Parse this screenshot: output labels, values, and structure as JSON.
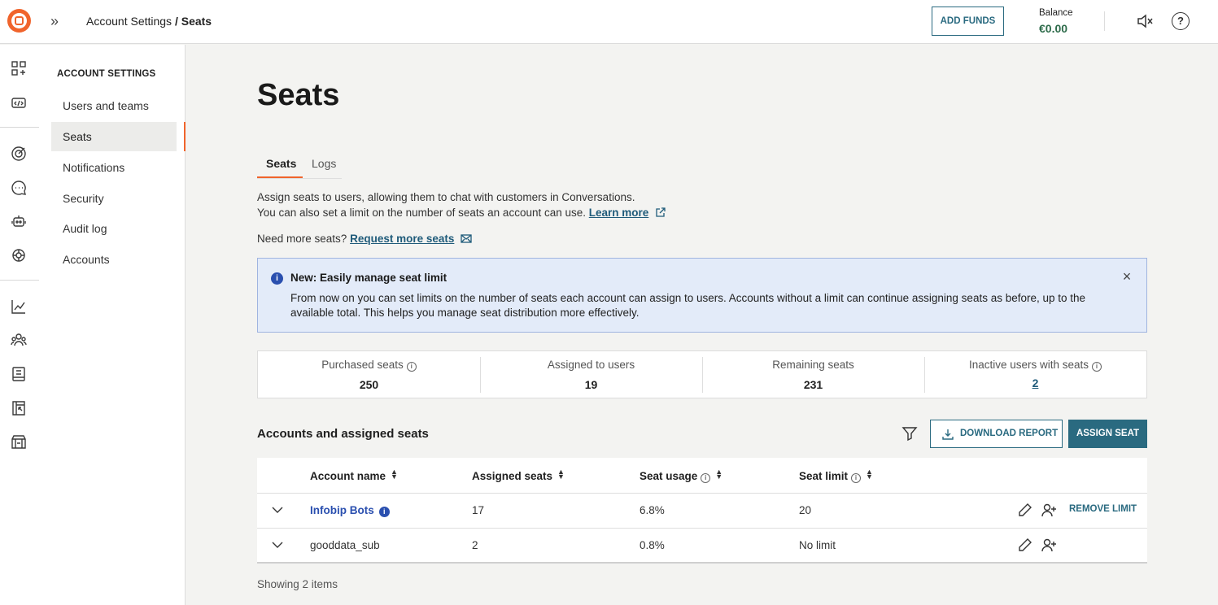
{
  "header": {
    "breadcrumb_parent": "Account Settings",
    "breadcrumb_sep": " / ",
    "breadcrumb_current": "Seats",
    "add_funds_label": "ADD FUNDS",
    "balance_label": "Balance",
    "balance_value": "€0.00"
  },
  "sidebar": {
    "title": "ACCOUNT SETTINGS",
    "items": [
      {
        "label": "Users and teams"
      },
      {
        "label": "Seats"
      },
      {
        "label": "Notifications"
      },
      {
        "label": "Security"
      },
      {
        "label": "Audit log"
      },
      {
        "label": "Accounts"
      }
    ]
  },
  "page": {
    "title": "Seats",
    "tabs": [
      {
        "label": "Seats"
      },
      {
        "label": "Logs"
      }
    ],
    "desc_line1": "Assign seats to users, allowing them to chat with customers in Conversations.",
    "desc_line2": "You can also set a limit on the number of seats an account can use.",
    "learn_more": "Learn more",
    "need_more": "Need more seats?",
    "request_more": "Request more seats"
  },
  "banner": {
    "title": "New: Easily manage seat limit",
    "text": "From now on you can set limits on the number of seats each account can assign to users. Accounts without a limit can continue assigning seats as before, up to the available total. This helps you manage seat distribution more effectively."
  },
  "stats": {
    "purchased_label": "Purchased seats",
    "purchased_value": "250",
    "assigned_label": "Assigned to users",
    "assigned_value": "19",
    "remaining_label": "Remaining seats",
    "remaining_value": "231",
    "inactive_label": "Inactive users with seats",
    "inactive_value": "2"
  },
  "table": {
    "section_title": "Accounts and assigned seats",
    "download_label": "DOWNLOAD REPORT",
    "assign_label": "ASSIGN SEAT",
    "headers": {
      "account": "Account name",
      "assigned": "Assigned seats",
      "usage": "Seat usage",
      "limit": "Seat limit"
    },
    "rows": [
      {
        "account": "Infobip Bots",
        "assigned": "17",
        "usage": "6.8%",
        "limit": "20",
        "action": "REMOVE LIMIT"
      },
      {
        "account": "gooddata_sub",
        "assigned": "2",
        "usage": "0.8%",
        "limit": "No limit"
      }
    ],
    "footer": "Showing 2 items"
  },
  "colors": {
    "accent": "#f0642c",
    "primary": "#2a6a80",
    "link": "#1f5b7a",
    "info": "#2a4faf",
    "balance": "#2d6b4a"
  }
}
